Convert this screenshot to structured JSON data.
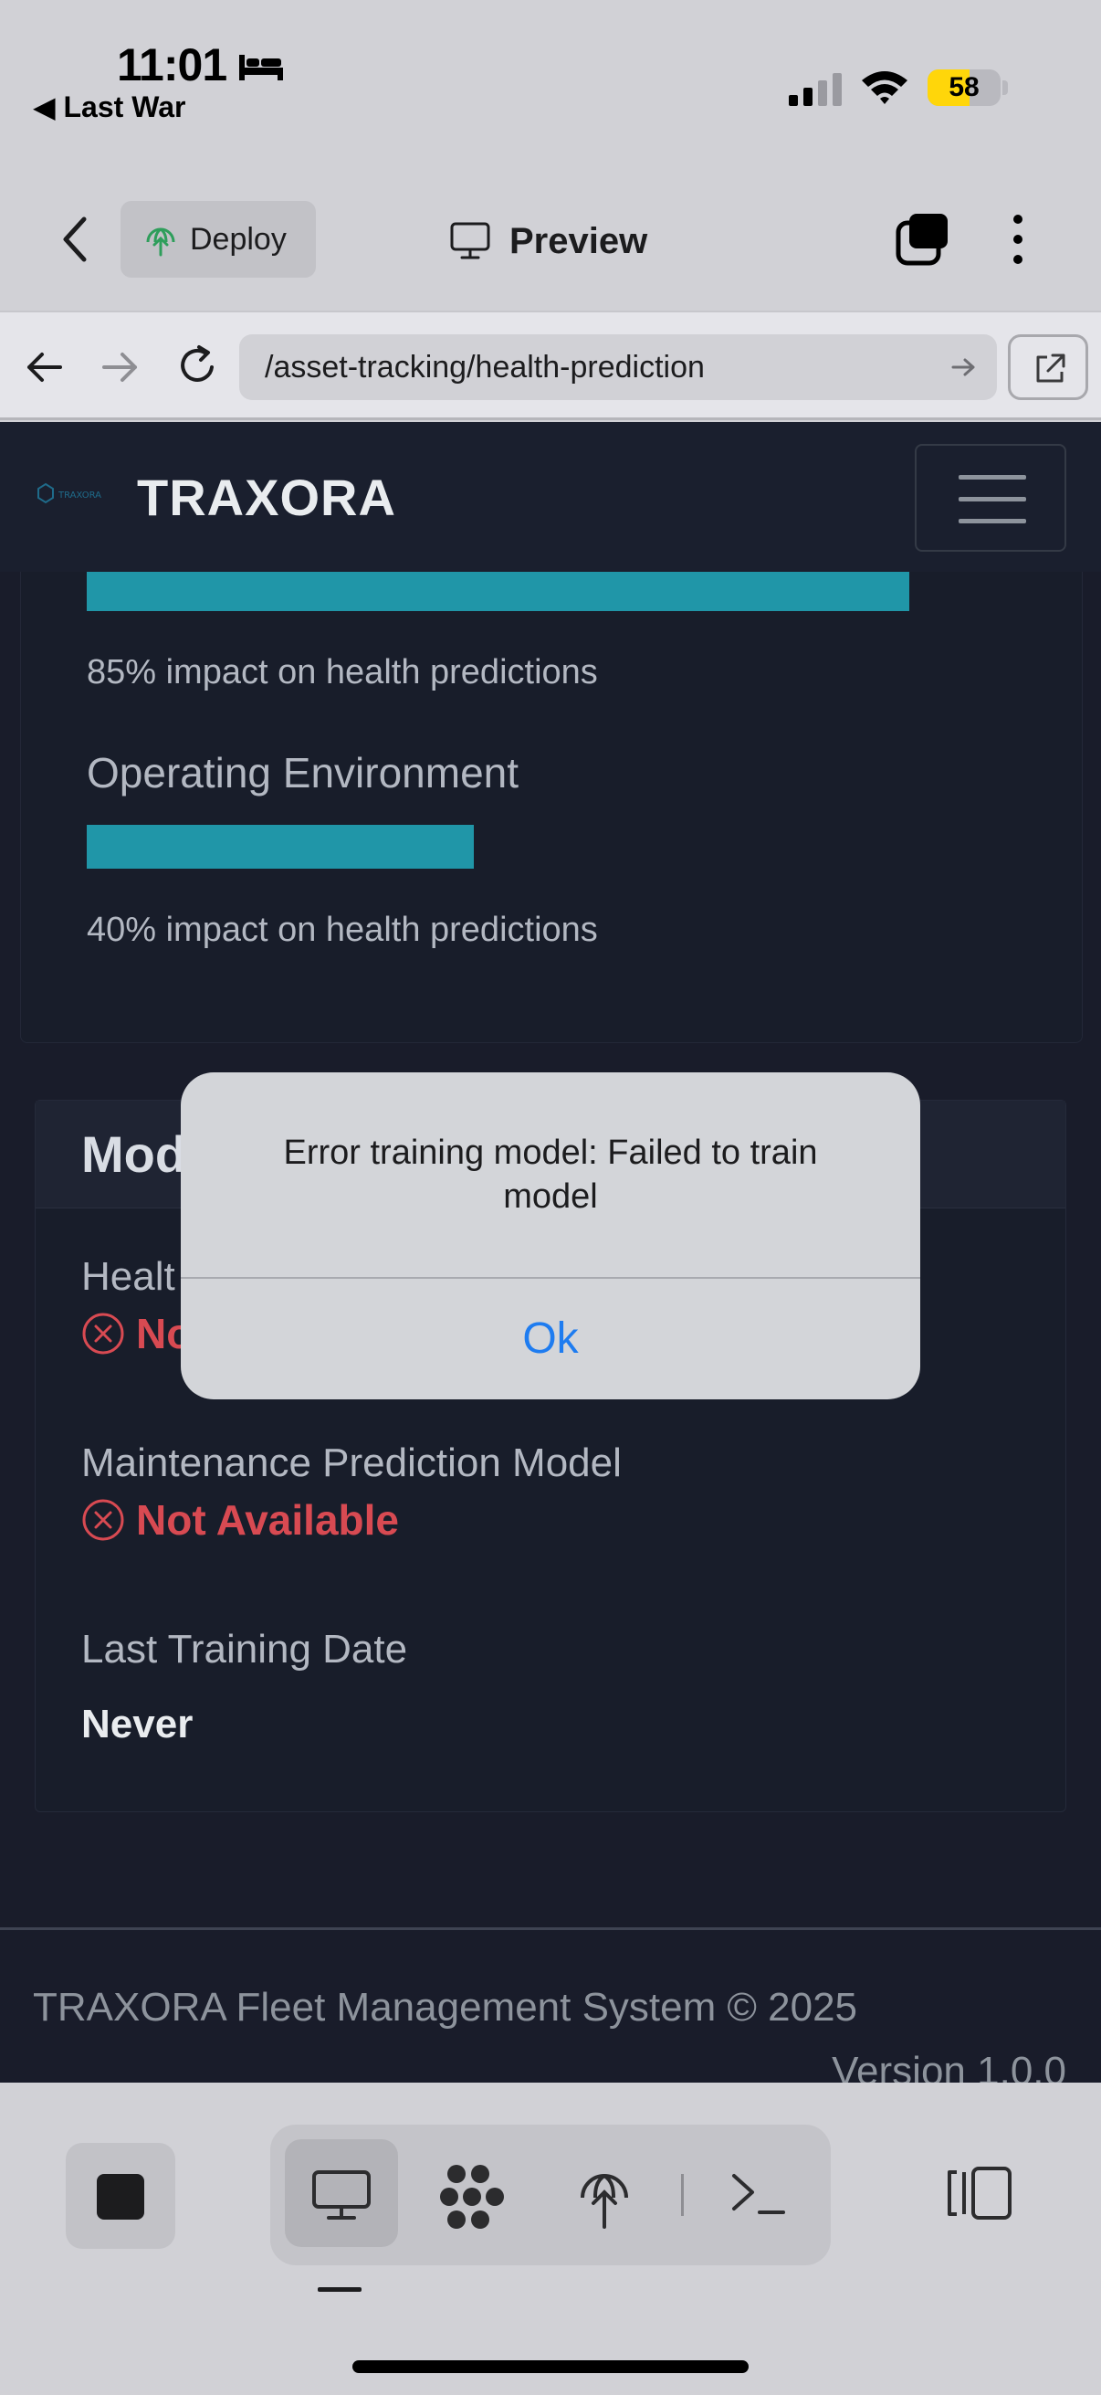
{
  "status_bar": {
    "time": "11:01",
    "back_app": "◀ Last War",
    "battery": "58",
    "battery_level": 0.58
  },
  "toolbar": {
    "deploy_label": "Deploy",
    "preview_label": "Preview"
  },
  "browser": {
    "url": "/asset-tracking/health-prediction"
  },
  "site": {
    "brand": "TRAXORA",
    "logo_text": "TRAXORA"
  },
  "factors": [
    {
      "name": "",
      "impact_percent": 85,
      "impact_text": "85% impact on health predictions"
    },
    {
      "name": "Operating Environment",
      "impact_percent": 40,
      "impact_text": "40% impact on health predictions"
    }
  ],
  "model_card": {
    "title": "Mod",
    "health_label": "Healt",
    "health_status": "No",
    "maintenance_label": "Maintenance Prediction Model",
    "maintenance_status": "Not Available",
    "last_training_label": "Last Training Date",
    "last_training_value": "Never"
  },
  "footer": {
    "text": "TRAXORA Fleet Management System © 2025",
    "version": "Version 1.0.0"
  },
  "alert": {
    "message": "Error training model: Failed to train model",
    "ok_label": "Ok"
  },
  "colors": {
    "accent_bar": "#2096a8",
    "error": "#d84a52",
    "link_blue": "#1e7cf0",
    "page_bg": "#191c2a"
  },
  "dock": {
    "icons": [
      "stop-icon",
      "monitor-icon",
      "dots-grid-icon",
      "deploy-globe-icon",
      "terminal-icon",
      "panel-icon"
    ]
  }
}
